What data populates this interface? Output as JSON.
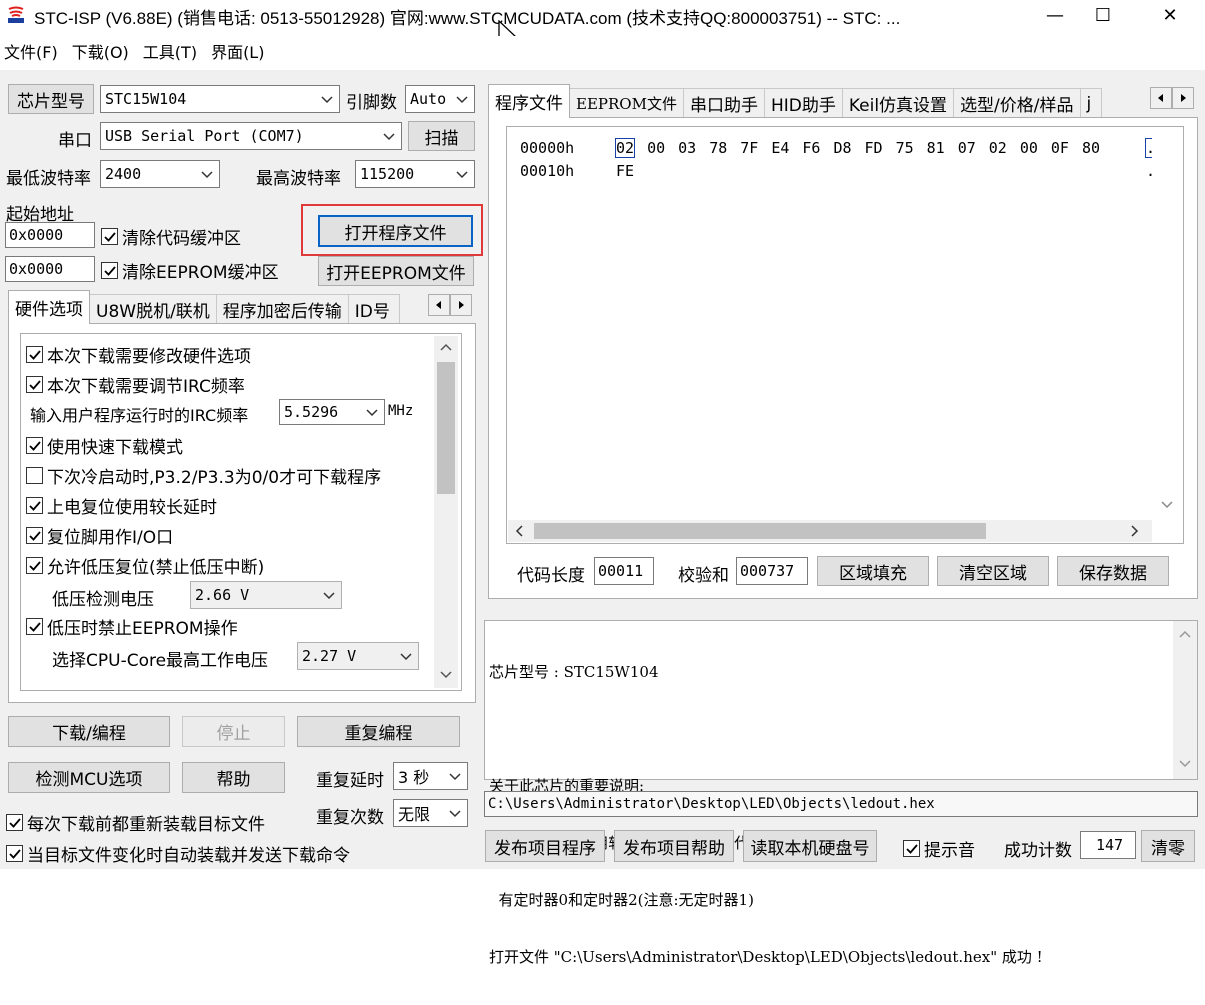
{
  "window": {
    "title": "STC-ISP (V6.88E) (销售电话: 0513-55012928) 官网:www.STCMCUDATA.com  (技术支持QQ:800003751) -- STC: ...",
    "minimize": "—",
    "maximize": "☐",
    "close": "✕"
  },
  "menu": [
    "文件(F)",
    "下载(O)",
    "工具(T)",
    "界面(L)"
  ],
  "left": {
    "chip_type_btn": "芯片型号",
    "chip_type_value": "STC15W104",
    "pins_label": "引脚数",
    "pins_value": "Auto",
    "port_label": "串口",
    "port_value": "USB Serial Port (COM7)",
    "scan_btn": "扫描",
    "min_baud_label": "最低波特率",
    "min_baud_value": "2400",
    "max_baud_label": "最高波特率",
    "max_baud_value": "115200",
    "start_addr_label": "起始地址",
    "addr1": "0x0000",
    "clear_code_label": "清除代码缓冲区",
    "open_program_btn": "打开程序文件",
    "addr2": "0x0000",
    "clear_eeprom_label": "清除EEPROM缓冲区",
    "open_eeprom_btn": "打开EEPROM文件",
    "highlight_color": "#e0393c"
  },
  "hw_tabs": [
    "硬件选项",
    "U8W脱机/联机",
    "程序加密后传输",
    "ID号"
  ],
  "hw_options": {
    "opt1": "本次下载需要修改硬件选项",
    "opt2": "本次下载需要调节IRC频率",
    "irc_label": "输入用户程序运行时的IRC频率",
    "irc_value": "5.5296",
    "irc_unit": "MHz",
    "opt3": "使用快速下载模式",
    "opt4": "下次冷启动时,P3.2/P3.3为0/0才可下载程序",
    "opt5": "上电复位使用较长延时",
    "opt6": "复位脚用作I/O口",
    "opt7": "允许低压复位(禁止低压中断)",
    "lv_label": "低压检测电压",
    "lv_value": "2.66 V",
    "opt8": "低压时禁止EEPROM操作",
    "cpu_label": "选择CPU-Core最高工作电压",
    "cpu_value": "2.27 V"
  },
  "bottom_left": {
    "download_btn": "下载/编程",
    "stop_btn": "停止",
    "reprogram_btn": "重复编程",
    "check_mcu_btn": "检测MCU选项",
    "help_btn": "帮助",
    "repeat_delay_label": "重复延时",
    "repeat_delay_value": "3 秒",
    "repeat_count_label": "重复次数",
    "repeat_count_value": "无限",
    "reload_label": "每次下载前都重新装载目标文件",
    "auto_load_label": "当目标文件变化时自动装载并发送下载命令"
  },
  "right_tabs": [
    "程序文件",
    "EEPROM文件",
    "串口助手",
    "HID助手",
    "Keil仿真设置",
    "选型/价格/样品",
    "j"
  ],
  "hex": {
    "rows": [
      {
        "addr": "00000h",
        "bytes": [
          "02",
          "00",
          "03",
          "78",
          "7F",
          "E4",
          "F6",
          "D8",
          "FD",
          "75",
          "81",
          "07",
          "02",
          "00",
          "0F",
          "80"
        ],
        "ascii": "."
      },
      {
        "addr": "00010h",
        "bytes": [
          "FE"
        ],
        "ascii": "."
      }
    ]
  },
  "code_info": {
    "code_len_label": "代码长度",
    "code_len_value": "00011",
    "checksum_label": "校验和",
    "checksum_value": "000737",
    "fill_btn": "区域填充",
    "clear_btn": "清空区域",
    "save_btn": "保存数据"
  },
  "log": {
    "lines": [
      "芯片型号 : STC15W104",
      "",
      "关于此芯片的重要说明:",
      "  无硬件串口,可用软件模拟串口(范例代码中有参考代码)",
      "  有定时器0和定时器2(注意:无定时器1)",
      "打开文件 \"C:\\Users\\Administrator\\Desktop\\LED\\Objects\\ledout.hex\" 成功 !"
    ]
  },
  "path": "C:\\Users\\Administrator\\Desktop\\LED\\Objects\\ledout.hex",
  "footer": {
    "publish_program_btn": "发布项目程序",
    "publish_help_btn": "发布项目帮助",
    "read_disk_btn": "读取本机硬盘号",
    "sound_label": "提示音",
    "success_count_label": "成功计数",
    "success_count_value": "147",
    "clear_count_btn": "清零"
  }
}
